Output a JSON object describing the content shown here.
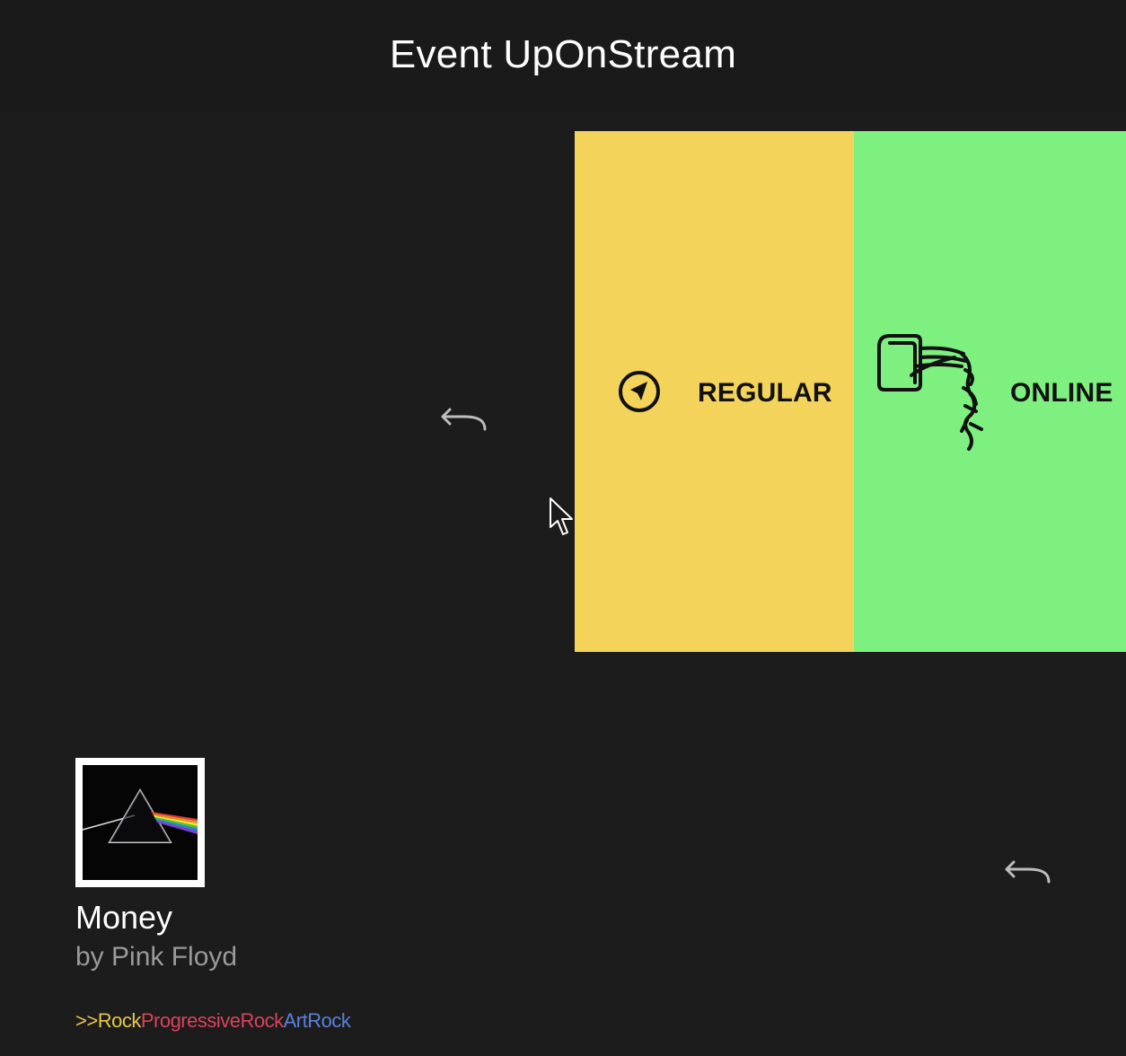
{
  "header": {
    "title": "Event UpOnStream"
  },
  "cards": {
    "regular": {
      "label": "REGULAR",
      "icon": "navigation-arrow-icon",
      "color": "#f4d35a"
    },
    "online": {
      "label": "ONLINE",
      "icon": "network-cable-icon",
      "color": "#7ef080"
    }
  },
  "back_buttons": {
    "icon": "return-arrow-icon"
  },
  "now_playing": {
    "album_art_icon": "dark-side-prism-cover",
    "title": "Money",
    "artist": "by Pink Floyd",
    "genre_prefix": ">>",
    "genres": [
      "Rock",
      "ProgressiveRock",
      "ArtRock"
    ],
    "genre_colors": [
      "#e6c84a",
      "#d9435d",
      "#5a82d8"
    ]
  }
}
